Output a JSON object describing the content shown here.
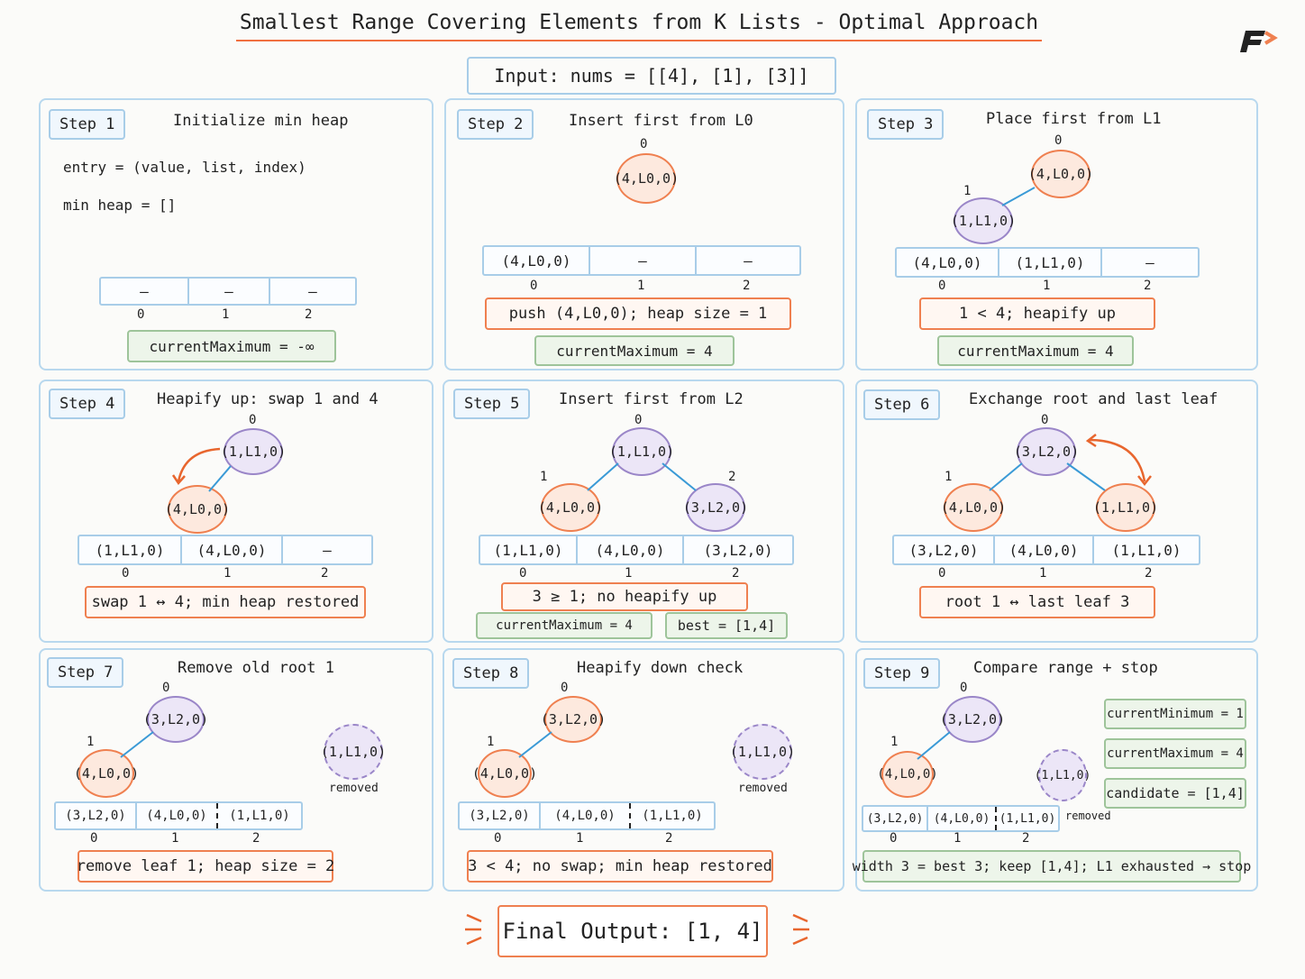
{
  "title": "Smallest Range Covering Elements from K Lists - Optimal Approach",
  "input": "Input:  nums = [[4], [1], [3]]",
  "final_output": "Final Output: [1, 4]",
  "removed_label": "removed",
  "steps": [
    {
      "step": "Step 1",
      "title": "Initialize min heap",
      "line1": "entry = (value, list, index)",
      "line2": "min heap = []",
      "array": [
        "–",
        "–",
        "–"
      ],
      "indices": [
        "0",
        "1",
        "2"
      ],
      "gbox": "currentMaximum = -∞"
    },
    {
      "step": "Step 2",
      "title": "Insert first from L0",
      "nodes": [
        "(4,L0,0)"
      ],
      "node_idx": [
        "0"
      ],
      "array": [
        "(4,L0,0)",
        "–",
        "–"
      ],
      "indices": [
        "0",
        "1",
        "2"
      ],
      "box": "push (4,L0,0); heap size = 1",
      "gbox": "currentMaximum = 4"
    },
    {
      "step": "Step 3",
      "title": "Place first from L1",
      "nodes": [
        "(4,L0,0)",
        "(1,L1,0)"
      ],
      "node_idx": [
        "0",
        "1"
      ],
      "array": [
        "(4,L0,0)",
        "(1,L1,0)",
        "–"
      ],
      "indices": [
        "0",
        "1",
        "2"
      ],
      "box": "1 < 4; heapify up",
      "gbox": "currentMaximum = 4"
    },
    {
      "step": "Step 4",
      "title": "Heapify up: swap 1 and 4",
      "nodes": [
        "(1,L1,0)",
        "(4,L0,0)"
      ],
      "node_idx": [
        "0"
      ],
      "array": [
        "(1,L1,0)",
        "(4,L0,0)",
        "–"
      ],
      "indices": [
        "0",
        "1",
        "2"
      ],
      "box": "swap 1 ↔ 4; min heap restored"
    },
    {
      "step": "Step 5",
      "title": "Insert first from L2",
      "nodes": [
        "(1,L1,0)",
        "(4,L0,0)",
        "(3,L2,0)"
      ],
      "node_idx": [
        "0",
        "1",
        "2"
      ],
      "array": [
        "(1,L1,0)",
        "(4,L0,0)",
        "(3,L2,0)"
      ],
      "indices": [
        "0",
        "1",
        "2"
      ],
      "box": "3 ≥ 1; no heapify up",
      "gbox": "currentMaximum = 4",
      "gbox2": "best = [1,4]"
    },
    {
      "step": "Step 6",
      "title": "Exchange root and last leaf",
      "nodes": [
        "(3,L2,0)",
        "(4,L0,0)",
        "(1,L1,0)"
      ],
      "node_idx": [
        "0",
        "1",
        "2"
      ],
      "array": [
        "(3,L2,0)",
        "(4,L0,0)",
        "(1,L1,0)"
      ],
      "indices": [
        "0",
        "1",
        "2"
      ],
      "box": "root 1 ↔ last leaf 3"
    },
    {
      "step": "Step 7",
      "title": "Remove old root 1",
      "nodes": [
        "(3,L2,0)",
        "(4,L0,0)",
        "(1,L1,0)"
      ],
      "node_idx": [
        "0",
        "1"
      ],
      "array": [
        "(3,L2,0)",
        "(4,L0,0)",
        "(1,L1,0)"
      ],
      "indices": [
        "0",
        "1",
        "2"
      ],
      "box": "remove leaf 1; heap size = 2"
    },
    {
      "step": "Step 8",
      "title": "Heapify down check",
      "nodes": [
        "(3,L2,0)",
        "(4,L0,0)",
        "(1,L1,0)"
      ],
      "node_idx": [
        "0",
        "1"
      ],
      "array": [
        "(3,L2,0)",
        "(4,L0,0)",
        "(1,L1,0)"
      ],
      "indices": [
        "0",
        "1",
        "2"
      ],
      "box": "3 < 4; no swap; min heap restored"
    },
    {
      "step": "Step 9",
      "title": "Compare range + stop",
      "nodes": [
        "(3,L2,0)",
        "(4,L0,0)",
        "(1,L1,0)"
      ],
      "node_idx": [
        "0",
        "1"
      ],
      "array": [
        "(3,L2,0)",
        "(4,L0,0)",
        "(1,L1,0)"
      ],
      "indices": [
        "0",
        "1",
        "2"
      ],
      "side": [
        "currentMinimum = 1",
        "currentMaximum = 4",
        "candidate = [1,4]"
      ],
      "box": "width 3 = best 3; keep [1,4]; L1 exhausted → stop"
    }
  ],
  "colors": {
    "orange": "#ef8050",
    "purple": "#9a86c8",
    "blue": "#a8cde8",
    "green": "#9ec49a",
    "edge": "#3a9ad6"
  }
}
